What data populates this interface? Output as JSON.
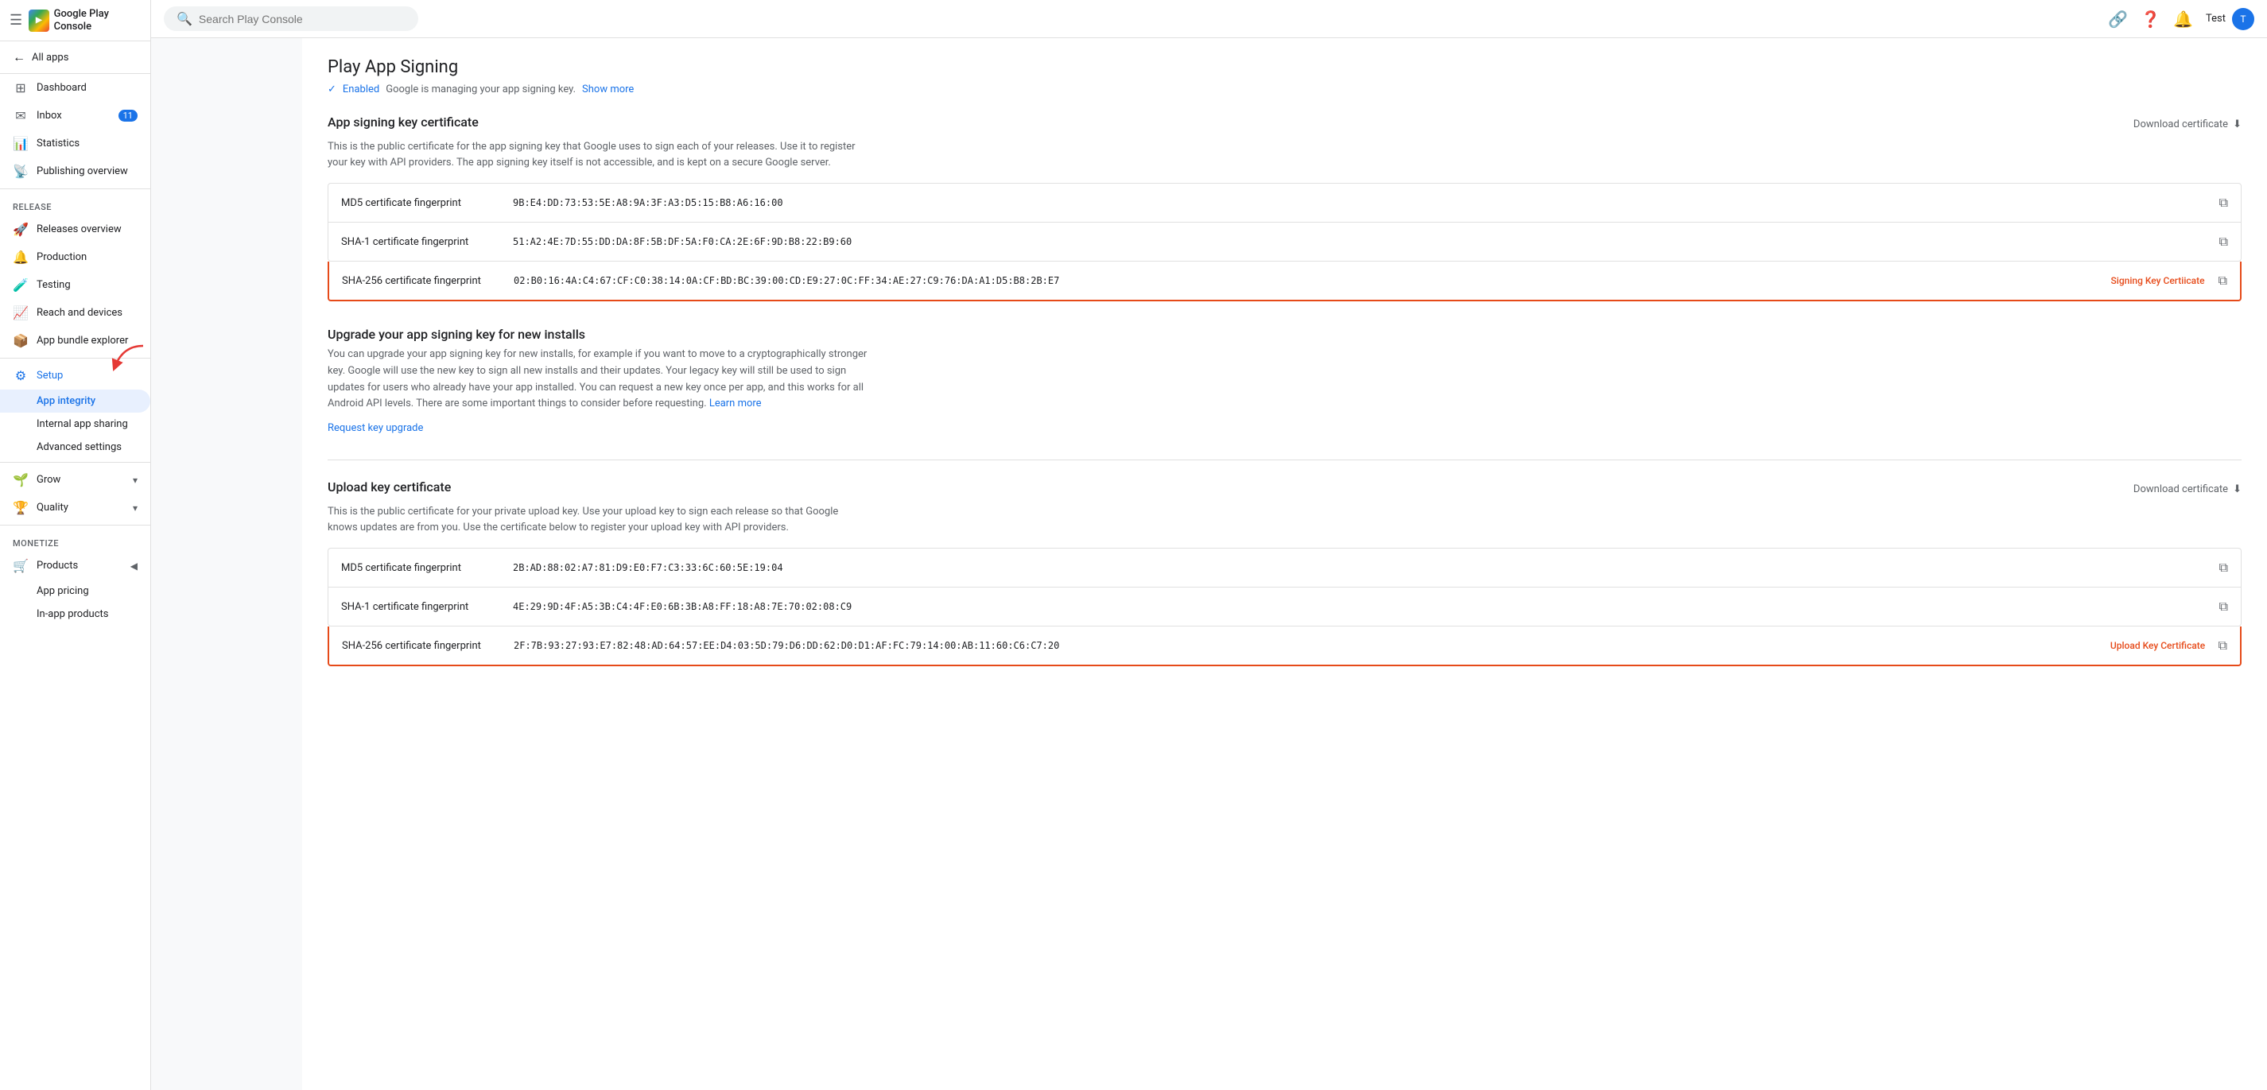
{
  "app": {
    "name": "Google Play Console"
  },
  "topbar": {
    "search_placeholder": "Search Play Console",
    "link_icon": "🔗",
    "help_icon": "?",
    "user_label": "Test"
  },
  "sidebar": {
    "all_apps_label": "All apps",
    "nav_items": [
      {
        "id": "dashboard",
        "label": "Dashboard",
        "icon": "⊞",
        "badge": null
      },
      {
        "id": "inbox",
        "label": "Inbox",
        "icon": "✉",
        "badge": "11"
      },
      {
        "id": "statistics",
        "label": "Statistics",
        "icon": "📊",
        "badge": null
      },
      {
        "id": "publishing",
        "label": "Publishing overview",
        "icon": "📡",
        "badge": null
      }
    ],
    "release_label": "Release",
    "release_items": [
      {
        "id": "releases-overview",
        "label": "Releases overview",
        "icon": "🚀"
      },
      {
        "id": "production",
        "label": "Production",
        "icon": "🔔"
      },
      {
        "id": "testing",
        "label": "Testing",
        "icon": "🧪"
      },
      {
        "id": "reach-devices",
        "label": "Reach and devices",
        "icon": "📈"
      },
      {
        "id": "app-bundle",
        "label": "App bundle explorer",
        "icon": "📦"
      }
    ],
    "setup_label": "Setup",
    "setup_icon": "⚙",
    "setup_items": [
      {
        "id": "app-integrity",
        "label": "App integrity",
        "active": true
      },
      {
        "id": "internal-sharing",
        "label": "Internal app sharing"
      },
      {
        "id": "advanced-settings",
        "label": "Advanced settings"
      }
    ],
    "grow_label": "Grow",
    "quality_label": "Quality",
    "monetize_label": "Monetize",
    "monetize_items": [
      {
        "id": "products",
        "label": "Products",
        "icon": "🛒"
      },
      {
        "id": "app-pricing",
        "label": "App pricing"
      },
      {
        "id": "in-app-products",
        "label": "In-app products"
      }
    ]
  },
  "main": {
    "page_title": "Play App Signing",
    "status_enabled": "Enabled",
    "status_desc": "Google is managing your app signing key.",
    "show_more": "Show more",
    "signing_key_section": {
      "title": "App signing key certificate",
      "description": "This is the public certificate for the app signing key that Google uses to sign each of your releases. Use it to register your key with API providers. The app signing key itself is not accessible, and is kept on a secure Google server.",
      "download_label": "Download certificate",
      "fingerprints": [
        {
          "label": "MD5 certificate fingerprint",
          "value": "9B:E4:DD:73:53:5E:A8:9A:3F:A3:D5:15:B8:A6:16:00",
          "highlighted": false,
          "tag": ""
        },
        {
          "label": "SHA-1 certificate fingerprint",
          "value": "51:A2:4E:7D:55:DD:DA:8F:5B:DF:5A:F0:CA:2E:6F:9D:B8:22:B9:60",
          "highlighted": false,
          "tag": ""
        },
        {
          "label": "SHA-256 certificate fingerprint",
          "value": "02:B0:16:4A:C4:67:CF:C0:38:14:0A:CF:BD:BC:39:00:CD:E9:27:0C:FF:34:AE:27:C9:76:DA:A1:D5:B8:2B:E7",
          "highlighted": true,
          "tag": "Signing Key Certiicate"
        }
      ]
    },
    "upgrade_section": {
      "title": "Upgrade your app signing key for new installs",
      "description": "You can upgrade your app signing key for new installs, for example if you want to move to a cryptographically stronger key. Google will use the new key to sign all new installs and their updates. Your legacy key will still be used to sign updates for users who already have your app installed. You can request a new key once per app, and this works for all Android API levels. There are some important things to consider before requesting.",
      "learn_more": "Learn more",
      "request_upgrade": "Request key upgrade"
    },
    "upload_key_section": {
      "title": "Upload key certificate",
      "description": "This is the public certificate for your private upload key. Use your upload key to sign each release so that Google knows updates are from you. Use the certificate below to register your upload key with API providers.",
      "download_label": "Download certificate",
      "fingerprints": [
        {
          "label": "MD5 certificate fingerprint",
          "value": "2B:AD:88:02:A7:81:D9:E0:F7:C3:33:6C:60:5E:19:04",
          "highlighted": false,
          "tag": ""
        },
        {
          "label": "SHA-1 certificate fingerprint",
          "value": "4E:29:9D:4F:A5:3B:C4:4F:E0:6B:3B:A8:FF:18:A8:7E:70:02:08:C9",
          "highlighted": false,
          "tag": ""
        },
        {
          "label": "SHA-256 certificate fingerprint",
          "value": "2F:7B:93:27:93:E7:82:48:AD:64:57:EE:D4:03:5D:79:D6:DD:62:D0:D1:AF:FC:79:14:00:AB:11:60:C6:C7:20",
          "highlighted": true,
          "tag": "Upload Key Certificate"
        }
      ]
    }
  }
}
